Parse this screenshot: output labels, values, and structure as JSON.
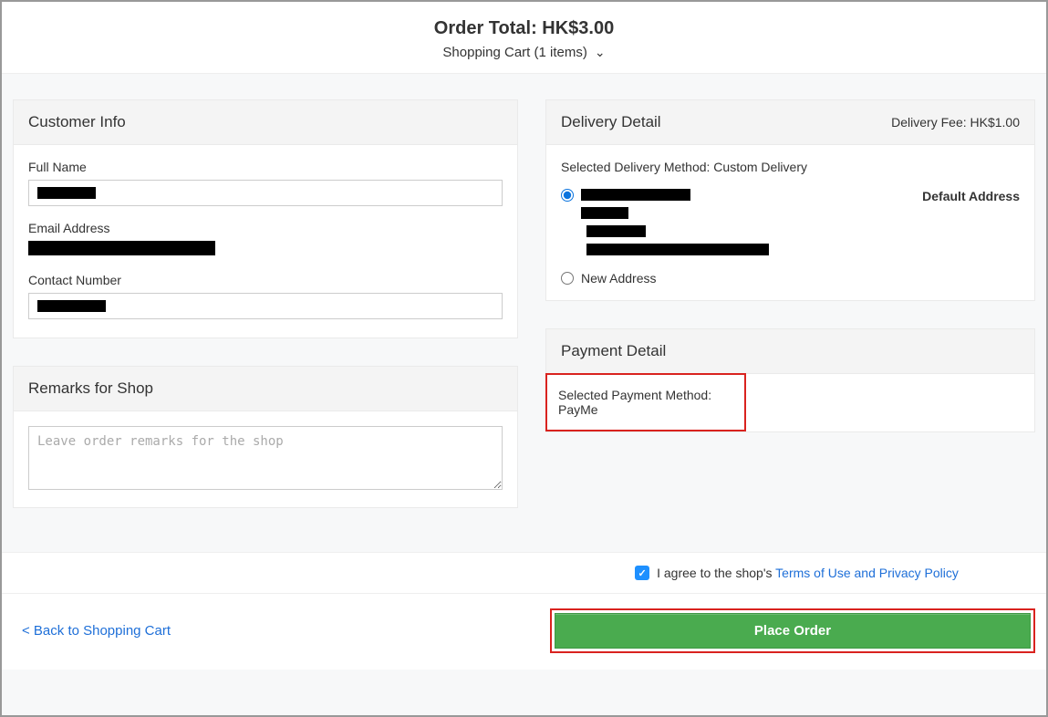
{
  "header": {
    "order_total_label": "Order Total:",
    "order_total_value": "HK$3.00",
    "cart_toggle": "Shopping Cart (1 items)"
  },
  "customer_info": {
    "title": "Customer Info",
    "full_name_label": "Full Name",
    "email_label": "Email Address",
    "contact_label": "Contact Number"
  },
  "remarks": {
    "title": "Remarks for Shop",
    "placeholder": "Leave order remarks for the shop"
  },
  "delivery": {
    "title": "Delivery Detail",
    "fee_label": "Delivery Fee: HK$1.00",
    "selected_method": "Selected Delivery Method: Custom Delivery",
    "default_address_badge": "Default Address",
    "new_address_label": "New Address"
  },
  "payment": {
    "title": "Payment Detail",
    "selected_method": "Selected Payment Method: PayMe"
  },
  "consent": {
    "prefix": "I agree to the shop's ",
    "link": "Terms of Use and Privacy Policy"
  },
  "footer": {
    "back_link": "< Back to Shopping Cart",
    "place_order": "Place Order"
  }
}
